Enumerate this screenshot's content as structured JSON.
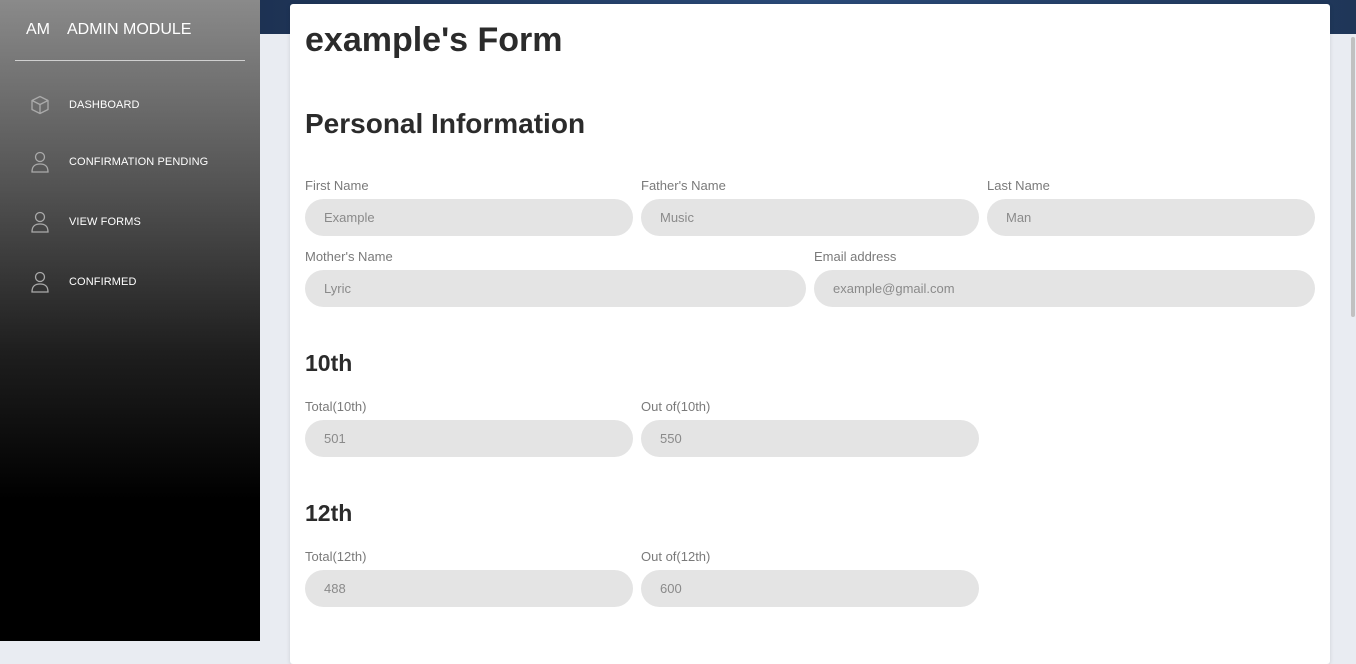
{
  "sidebar": {
    "brand_mini": "AM",
    "brand_name": "ADMIN MODULE",
    "items": [
      {
        "label": "DASHBOARD",
        "icon": "cube-icon"
      },
      {
        "label": "CONFIRMATION PENDING",
        "icon": "user-icon"
      },
      {
        "label": "VIEW FORMS",
        "icon": "user-icon"
      },
      {
        "label": "CONFIRMED",
        "icon": "user-icon"
      }
    ]
  },
  "form": {
    "title": "example's Form",
    "personal": {
      "heading": "Personal Information",
      "first_name": {
        "label": "First Name",
        "value": "Example"
      },
      "fathers_name": {
        "label": "Father's Name",
        "value": "Music"
      },
      "last_name": {
        "label": "Last Name",
        "value": "Man"
      },
      "mothers_name": {
        "label": "Mother's Name",
        "value": "Lyric"
      },
      "email": {
        "label": "Email address",
        "value": "example@gmail.com"
      }
    },
    "tenth": {
      "heading": "10th",
      "total": {
        "label": "Total(10th)",
        "value": "501"
      },
      "out_of": {
        "label": "Out of(10th)",
        "value": "550"
      }
    },
    "twelfth": {
      "heading": "12th",
      "total": {
        "label": "Total(12th)",
        "value": "488"
      },
      "out_of": {
        "label": "Out of(12th)",
        "value": "600"
      }
    }
  },
  "colors": {
    "sidebar_top": "#8a8a8a",
    "sidebar_bottom": "#000000",
    "topbar": "#2a4a78",
    "field_bg": "#e4e4e4"
  }
}
